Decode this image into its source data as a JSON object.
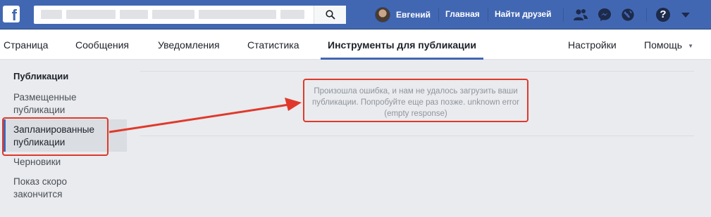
{
  "topbar": {
    "logo": "f",
    "search": {
      "value": "",
      "icon": "search-icon"
    },
    "profile_name": "Евгений",
    "links": [
      "Главная",
      "Найти друзей"
    ],
    "icons": [
      "friends-icon",
      "messenger-icon",
      "globe-icon",
      "help-icon",
      "chevron-down-icon"
    ],
    "help_glyph": "?"
  },
  "nav": {
    "tabs": [
      "Страница",
      "Сообщения",
      "Уведомления",
      "Статистика",
      "Инструменты для публикации"
    ],
    "active_tab": "Инструменты для публикации",
    "right": [
      "Настройки",
      "Помощь"
    ],
    "caret": "▼"
  },
  "sidebar": {
    "title": "Публикации",
    "items": [
      {
        "label": "Размещенные публикации"
      },
      {
        "label": "Запланированные публикации",
        "active": true
      },
      {
        "label": "Черновики"
      },
      {
        "label": "Показ скоро закончится"
      }
    ]
  },
  "main": {
    "error_text": "Произошла ошибка, и нам не удалось загрузить ваши публикации. Попробуйте еще раз позже. unknown error (empty response)"
  },
  "colors": {
    "brand": "#4267b2",
    "annotation_red": "#e0392b",
    "page_bg": "#e9ebee"
  }
}
